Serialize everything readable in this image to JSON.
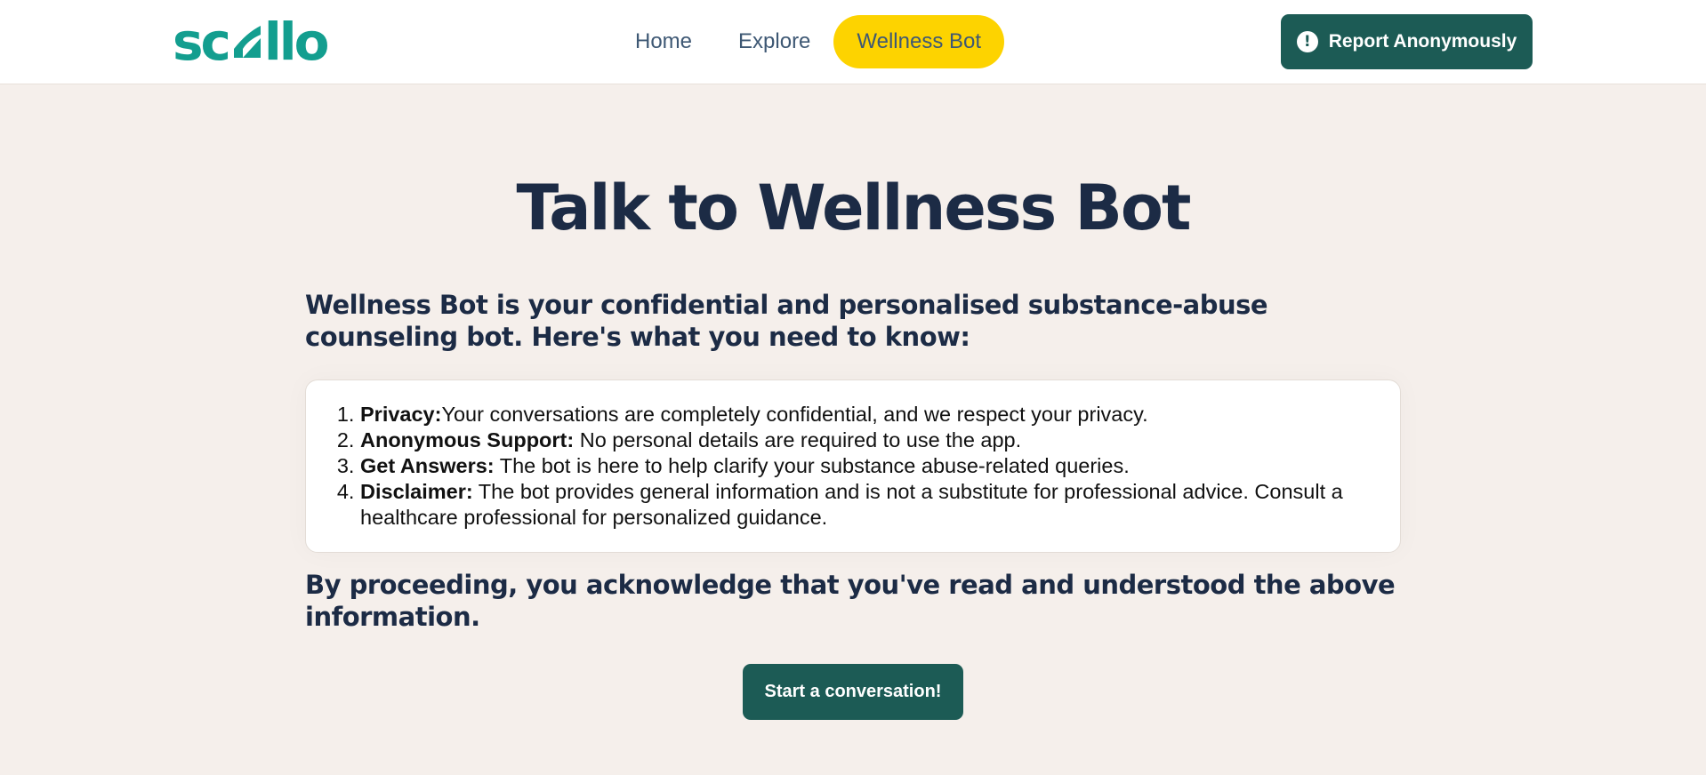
{
  "nav": {
    "logo": {
      "text_left": "sc",
      "text_right": "llo",
      "color": "#139e8f"
    },
    "links": [
      {
        "label": "Home",
        "active": false
      },
      {
        "label": "Explore",
        "active": false
      },
      {
        "label": "Wellness Bot",
        "active": true
      }
    ],
    "report_button": {
      "label": "Report Anonymously",
      "icon": "alert-circle-icon"
    }
  },
  "main": {
    "title": "Talk to Wellness Bot",
    "intro": "Wellness Bot is your confidential and personalised substance-abuse counseling bot. Here's what you need to know:",
    "items": [
      {
        "term": "Privacy:",
        "text": "Your conversations are completely confidential, and we respect your privacy."
      },
      {
        "term": "Anonymous Support:",
        "text": " No personal details are required to use the app."
      },
      {
        "term": "Get Answers:",
        "text": " The bot is here to help clarify your substance abuse-related queries."
      },
      {
        "term": "Disclaimer:",
        "text": " The bot provides general information and is not a substitute for professional advice. Consult a healthcare professional for personalized guidance."
      }
    ],
    "acknowledgement": "By proceeding, you acknowledge that you've read and understood the above information.",
    "start_button": "Start a conversation!"
  },
  "colors": {
    "accent": "#1c5b55",
    "active_tab": "#fdd300",
    "background": "#f5efeb",
    "heading": "#1c2b45"
  }
}
